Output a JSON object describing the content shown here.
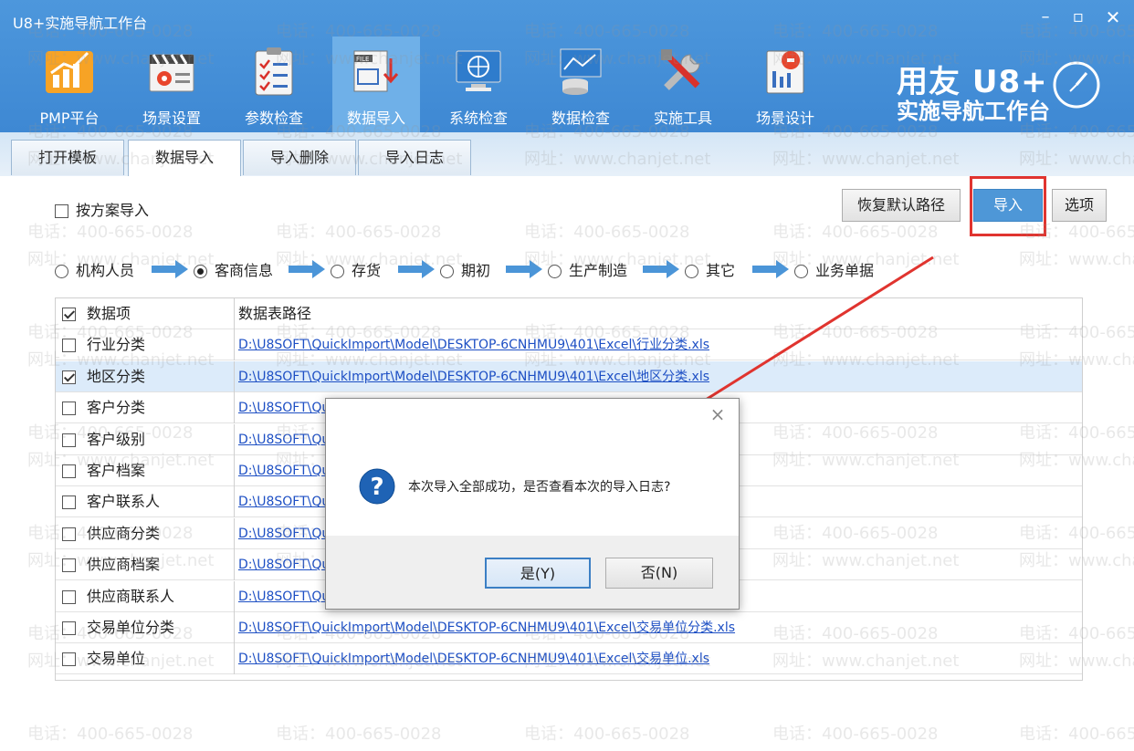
{
  "window": {
    "title": "U8+实施导航工作台",
    "controls": {
      "minimize": "–",
      "maximize": "▫",
      "close": "✕"
    }
  },
  "toolbar": {
    "items": [
      {
        "label": "PMP平台",
        "icon": "pmp-chart-icon"
      },
      {
        "label": "场景设置",
        "icon": "scene-settings-icon"
      },
      {
        "label": "参数检查",
        "icon": "parameter-check-icon"
      },
      {
        "label": "数据导入",
        "icon": "data-import-icon",
        "active": true
      },
      {
        "label": "系统检查",
        "icon": "system-check-icon"
      },
      {
        "label": "数据检查",
        "icon": "data-check-icon"
      },
      {
        "label": "实施工具",
        "icon": "implementation-tools-icon"
      },
      {
        "label": "场景设计",
        "icon": "scene-design-icon"
      }
    ]
  },
  "brand": {
    "line1": "用友 U8+",
    "line2": "实施导航工作台"
  },
  "tabs": [
    {
      "label": "打开模板"
    },
    {
      "label": "数据导入",
      "active": true
    },
    {
      "label": "导入删除"
    },
    {
      "label": "导入日志"
    }
  ],
  "options": {
    "scheme_import_label": "按方案导入",
    "restore_default_path_label": "恢复默认路径",
    "import_label": "导入",
    "options_label": "选项"
  },
  "steps": [
    {
      "label": "机构人员",
      "selected": false
    },
    {
      "label": "客商信息",
      "selected": true
    },
    {
      "label": "存货",
      "selected": false
    },
    {
      "label": "期初",
      "selected": false
    },
    {
      "label": "生产制造",
      "selected": false
    },
    {
      "label": "其它",
      "selected": false
    },
    {
      "label": "业务单据",
      "selected": false
    }
  ],
  "table": {
    "col_item": "数据项",
    "col_path": "数据表路径",
    "header_checked": true,
    "rows": [
      {
        "name": "行业分类",
        "checked": false,
        "path": "D:\\U8SOFT\\QuickImport\\Model\\DESKTOP-6CNHMU9\\401\\Excel\\行业分类.xls"
      },
      {
        "name": "地区分类",
        "checked": true,
        "path": "D:\\U8SOFT\\QuickImport\\Model\\DESKTOP-6CNHMU9\\401\\Excel\\地区分类.xls",
        "highlight": true
      },
      {
        "name": "客户分类",
        "checked": false,
        "path": "D:\\U8SOFT\\Qu"
      },
      {
        "name": "客户级别",
        "checked": false,
        "path": "D:\\U8SOFT\\Qu"
      },
      {
        "name": "客户档案",
        "checked": false,
        "path": "D:\\U8SOFT\\Qu"
      },
      {
        "name": "客户联系人",
        "checked": false,
        "path": "D:\\U8SOFT\\Qu"
      },
      {
        "name": "供应商分类",
        "checked": false,
        "path": "D:\\U8SOFT\\Qu"
      },
      {
        "name": "供应商档案",
        "checked": false,
        "path": "D:\\U8SOFT\\Qu"
      },
      {
        "name": "供应商联系人",
        "checked": false,
        "path": "D:\\U8SOFT\\Qu"
      },
      {
        "name": "交易单位分类",
        "checked": false,
        "path": "D:\\U8SOFT\\QuickImport\\Model\\DESKTOP-6CNHMU9\\401\\Excel\\交易单位分类.xls"
      },
      {
        "name": "交易单位",
        "checked": false,
        "path": "D:\\U8SOFT\\QuickImport\\Model\\DESKTOP-6CNHMU9\\401\\Excel\\交易单位.xls"
      }
    ]
  },
  "dialog": {
    "message": "本次导入全部成功，是否查看本次的导入日志?",
    "yes_label": "是(Y)",
    "no_label": "否(N)",
    "close": "×",
    "icon": "question-icon"
  },
  "watermark": {
    "phone": "电话：400-665-0028",
    "site": "网址：www.chanjet.net"
  },
  "colors": {
    "header_blue": "#4d97dc",
    "active_tool": "#6fb0e8",
    "import_button": "#4e97d7",
    "highlight_box": "#e0342f",
    "link_blue": "#1d4fc4",
    "row_highlight": "#dcebfa"
  }
}
